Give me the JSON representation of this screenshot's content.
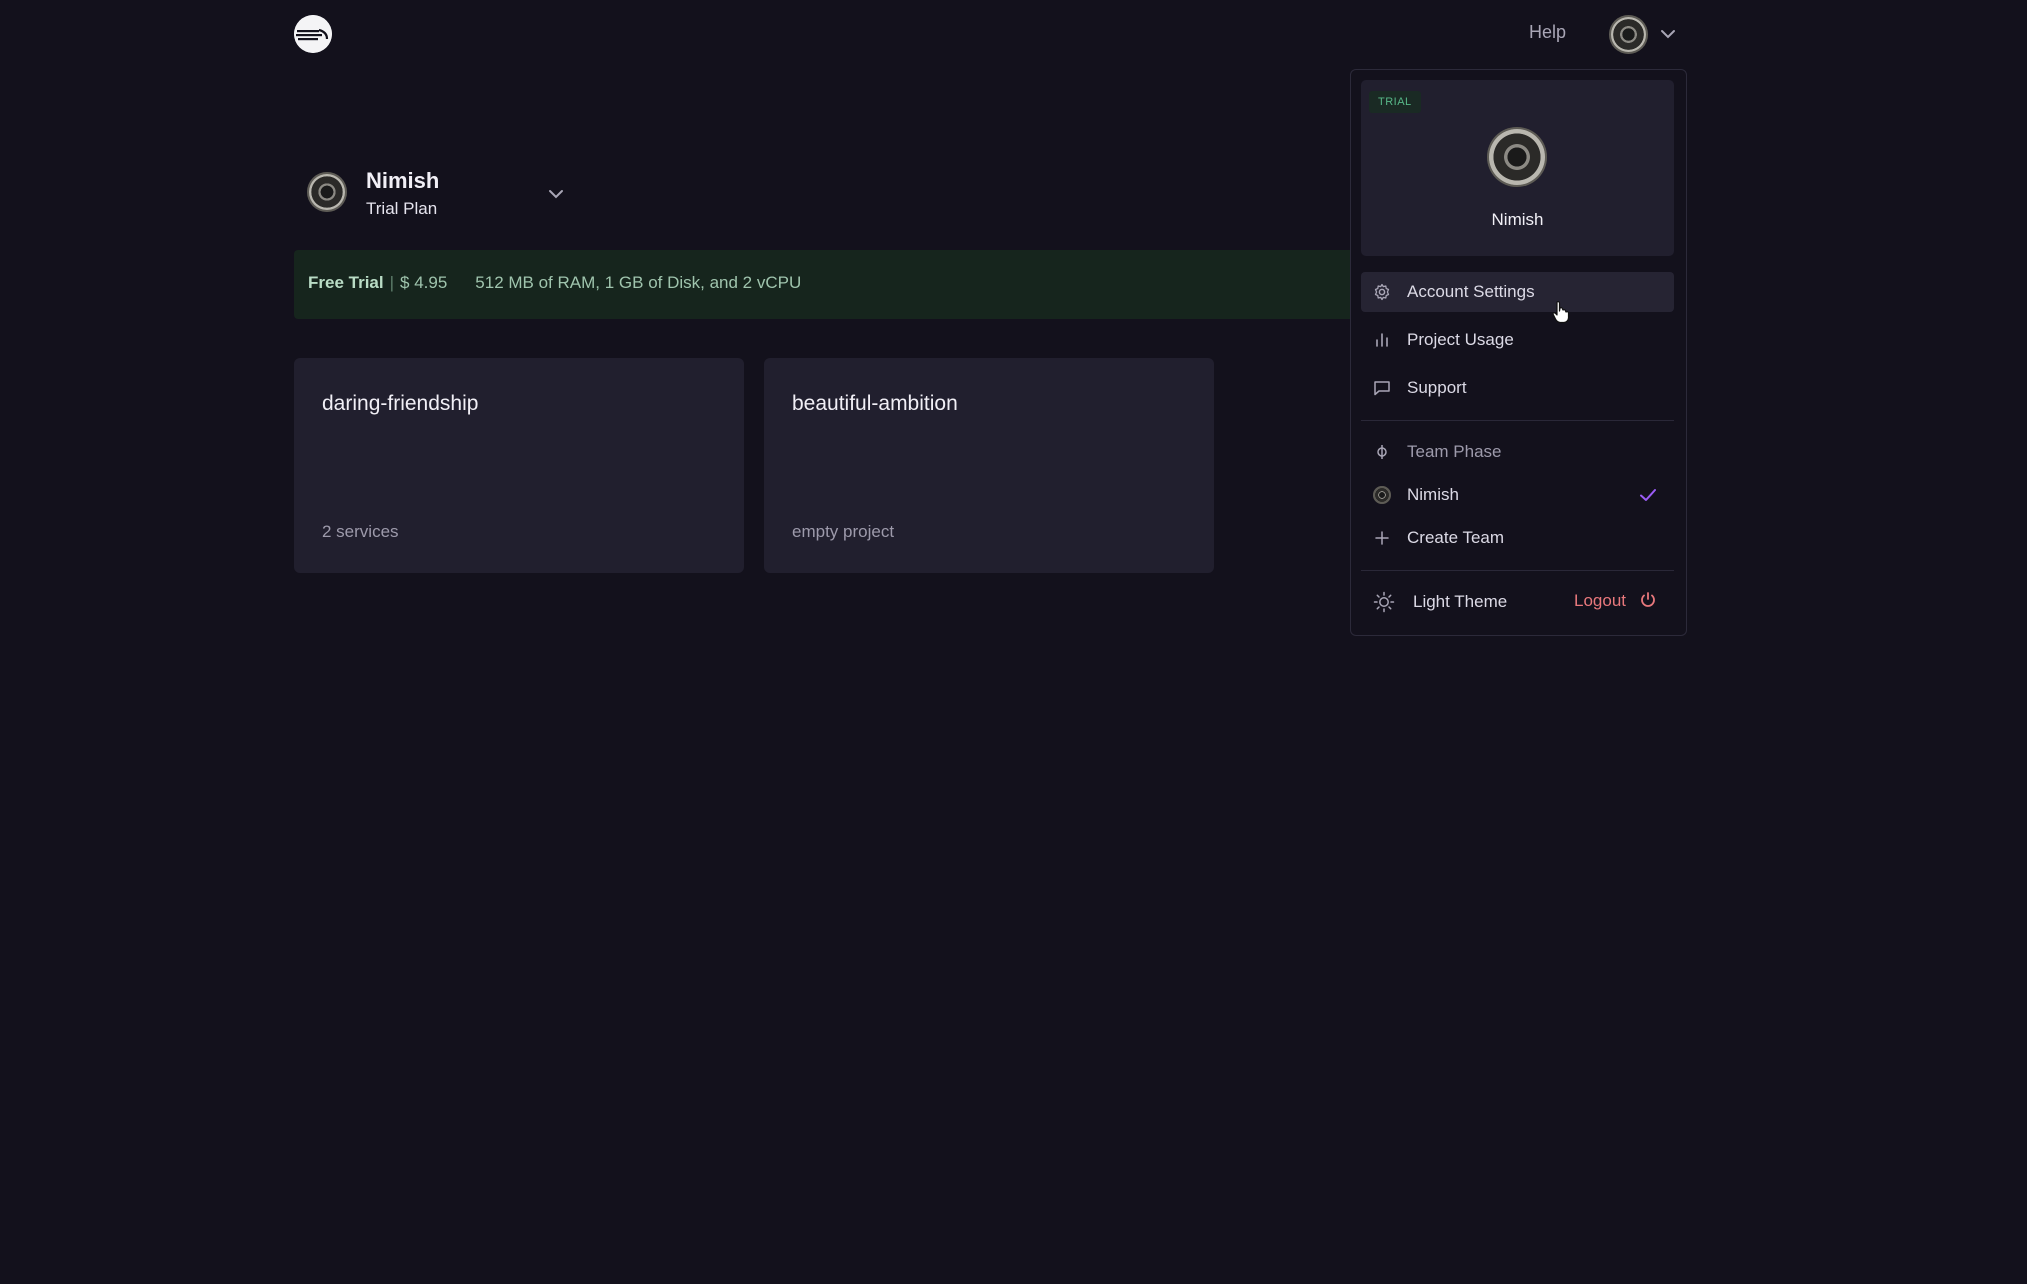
{
  "header": {
    "logo_icon": "railway-logo-icon",
    "help_label": "Help",
    "avatar_icon": "user-avatar",
    "menu_chevron_icon": "chevron-down-icon"
  },
  "team": {
    "name": "Nimish",
    "plan": "Trial Plan"
  },
  "banner": {
    "plan": "Free Trial",
    "price": "$ 4.95",
    "spec": "512 MB of RAM, 1 GB of Disk, and 2 vCPU"
  },
  "projects": [
    {
      "name": "daring-friendship",
      "subtitle": "2 services"
    },
    {
      "name": "beautiful-ambition",
      "subtitle": "empty project"
    }
  ],
  "menu": {
    "badge": "TRIAL",
    "profile_name": "Nimish",
    "items": [
      {
        "label": "Account Settings",
        "icon": "gear-icon"
      },
      {
        "label": "Project Usage",
        "icon": "bar-chart-icon"
      },
      {
        "label": "Support",
        "icon": "chat-bubble-icon"
      }
    ],
    "teams": [
      {
        "label": "Team Phase",
        "icon": "phase-icon"
      },
      {
        "label": "Nimish",
        "icon": "user-avatar",
        "selected": true
      },
      {
        "label": "Create Team",
        "icon": "plus-icon"
      }
    ],
    "theme_label": "Light Theme",
    "logout_label": "Logout"
  },
  "colors": {
    "background": "#13111c",
    "card": "#211f2e",
    "banner": "#16251d",
    "accent_check": "#9b5cf6",
    "logout": "#e8787c"
  }
}
